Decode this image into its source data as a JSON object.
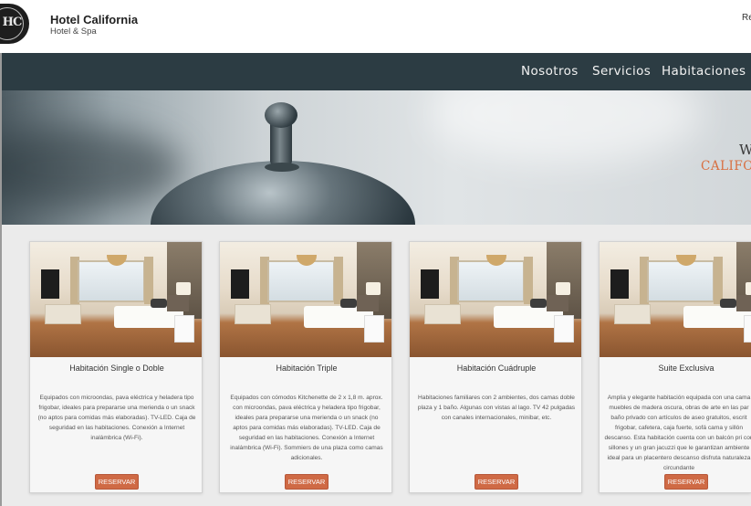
{
  "header": {
    "logo_text": "HC",
    "brand_title": "Hotel California",
    "brand_subtitle": "Hotel & Spa",
    "top_right_text": "Re"
  },
  "nav": {
    "items": [
      {
        "label": "Nosotros"
      },
      {
        "label": "Servicios"
      },
      {
        "label": "Habitaciones"
      }
    ]
  },
  "hero": {
    "welcome_fragment": "W",
    "name_fragment": "CALIFO"
  },
  "cards": [
    {
      "title": "Habitación Single o Doble",
      "description": "Equipados con microondas, pava eléctrica y heladera tipo frigobar, ideales para prepararse una merienda o un snack (no aptos para comidas más elaboradas). TV-LED. Caja de seguridad en las habitaciones. Conexión a Internet inalámbrica (Wi-Fi).",
      "button": "RESERVAR"
    },
    {
      "title": "Habitación Triple",
      "description": "Equipados con cómodos Kitchenette de 2 x 1,8 m. aprox. con microondas, pava eléctrica y heladera tipo frigobar, ideales para prepararse una merienda o un snack (no aptos para comidas más elaboradas). TV-LED. Caja de seguridad en las habitaciones. Conexión a Internet inalámbrica (Wi-Fi). Sommiers de una plaza como camas adicionales.",
      "button": "RESERVAR"
    },
    {
      "title": "Habitación Cuádruple",
      "description": "Habitaciones familiares con 2 ambientes, dos camas doble plaza y 1 baño. Algunas con vistas al lago. TV 42 pulgadas con canales internacionales, minibar, etc.",
      "button": "RESERVAR"
    },
    {
      "title": "Suite Exclusiva",
      "description": "Amplia y elegante habitación equipada con una cama muebles de madera oscura, obras de arte en las par baño privado con artículos de aseo gratuitos, escrit frigobar, cafetera, caja fuerte, sofá cama y sillón descanso. Esta habitación cuenta con un balcón pri con sillones y un gran jacuzzi que le garantizan ambiente ideal para un placentero descanso disfruta naturaleza circundante",
      "button": "RESERVAR"
    }
  ]
}
